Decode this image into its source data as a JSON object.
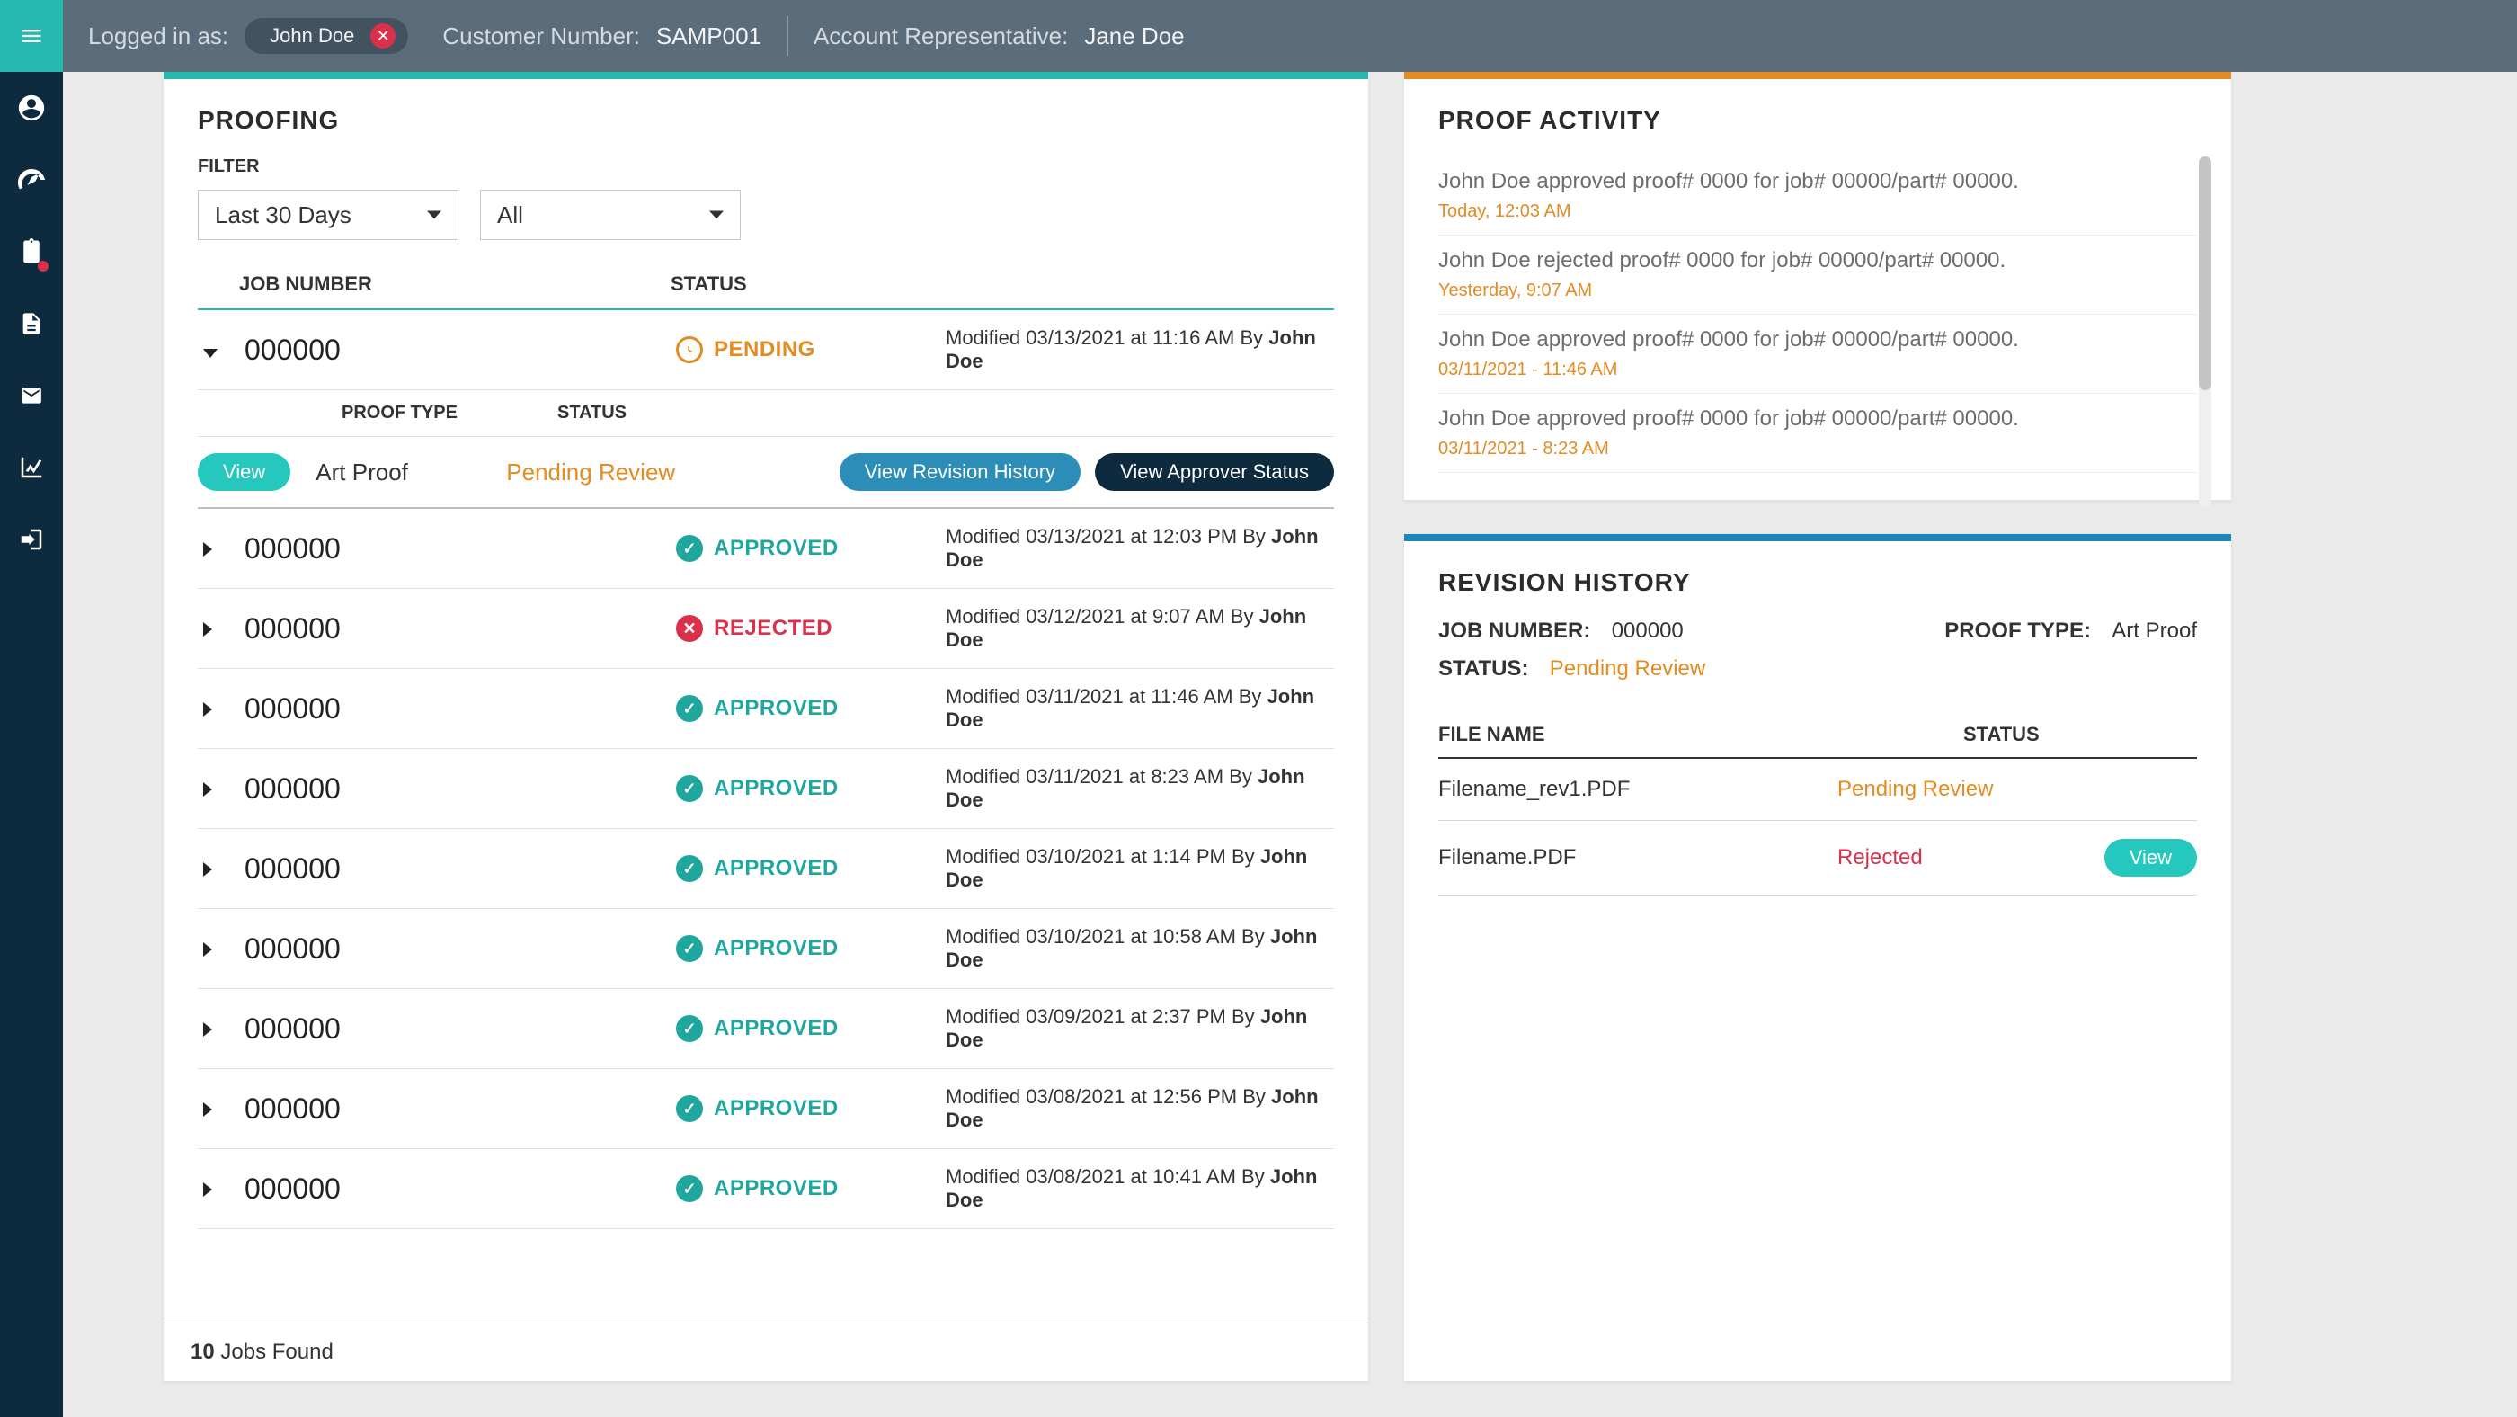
{
  "topbar": {
    "logged_in_as_label": "Logged in as:",
    "user_name": "John Doe",
    "customer_number_label": "Customer Number:",
    "customer_number": "SAMP001",
    "account_rep_label": "Account Representative:",
    "account_rep": "Jane Doe"
  },
  "sidebar": {
    "icons": [
      "menu-icon",
      "user-circle-icon",
      "gauge-icon",
      "clipboard-icon",
      "file-icon",
      "mail-icon",
      "chart-line-icon",
      "logout-icon"
    ]
  },
  "proofing": {
    "title": "PROOFING",
    "filter_label": "FILTER",
    "filter_time": "Last 30 Days",
    "filter_status": "All",
    "columns": {
      "job": "JOB NUMBER",
      "status": "STATUS"
    },
    "expanded": {
      "job": "000000",
      "status_label": "PENDING",
      "modified_prefix": "Modified",
      "modified_date": "03/13/2021",
      "modified_at": "at",
      "modified_time": "11:16 AM",
      "by_label": "By",
      "by_name": "John Doe",
      "sub_columns": {
        "proof_type": "PROOF TYPE",
        "status": "STATUS"
      },
      "sub_view": "View",
      "sub_proof_type": "Art Proof",
      "sub_status": "Pending Review",
      "btn_revision": "View Revision History",
      "btn_approver": "View Approver Status"
    },
    "rows": [
      {
        "job": "000000",
        "status": "APPROVED",
        "date": "03/13/2021",
        "time": "12:03 PM",
        "by": "John Doe"
      },
      {
        "job": "000000",
        "status": "REJECTED",
        "date": "03/12/2021",
        "time": "9:07 AM",
        "by": "John Doe"
      },
      {
        "job": "000000",
        "status": "APPROVED",
        "date": "03/11/2021",
        "time": "11:46 AM",
        "by": "John Doe"
      },
      {
        "job": "000000",
        "status": "APPROVED",
        "date": "03/11/2021",
        "time": "8:23 AM",
        "by": "John Doe"
      },
      {
        "job": "000000",
        "status": "APPROVED",
        "date": "03/10/2021",
        "time": "1:14 PM",
        "by": "John Doe"
      },
      {
        "job": "000000",
        "status": "APPROVED",
        "date": "03/10/2021",
        "time": "10:58 AM",
        "by": "John Doe"
      },
      {
        "job": "000000",
        "status": "APPROVED",
        "date": "03/09/2021",
        "time": "2:37 PM",
        "by": "John Doe"
      },
      {
        "job": "000000",
        "status": "APPROVED",
        "date": "03/08/2021",
        "time": "12:56 PM",
        "by": "John Doe"
      },
      {
        "job": "000000",
        "status": "APPROVED",
        "date": "03/08/2021",
        "time": "10:41 AM",
        "by": "John Doe"
      }
    ],
    "footer_count": "10",
    "footer_text": "Jobs Found"
  },
  "activity": {
    "title": "PROOF ACTIVITY",
    "items": [
      {
        "text": "John Doe approved proof# 0000 for job# 00000/part# 00000.",
        "time": "Today, 12:03 AM"
      },
      {
        "text": "John Doe rejected proof# 0000 for job# 00000/part# 00000.",
        "time": "Yesterday, 9:07 AM"
      },
      {
        "text": "John Doe approved proof# 0000 for job# 00000/part# 00000.",
        "time": "03/11/2021 - 11:46 AM"
      },
      {
        "text": "John Doe approved proof# 0000 for job# 00000/part# 00000.",
        "time": "03/11/2021 - 8:23 AM"
      }
    ]
  },
  "revision": {
    "title": "REVISION HISTORY",
    "job_label": "JOB NUMBER:",
    "job": "000000",
    "proof_type_label": "PROOF TYPE:",
    "proof_type": "Art Proof",
    "status_label": "STATUS:",
    "status": "Pending Review",
    "columns": {
      "file": "FILE NAME",
      "status": "STATUS"
    },
    "rows": [
      {
        "file": "Filename_rev1.PDF",
        "status": "Pending Review",
        "view": ""
      },
      {
        "file": "Filename.PDF",
        "status": "Rejected",
        "view": "View"
      }
    ]
  }
}
